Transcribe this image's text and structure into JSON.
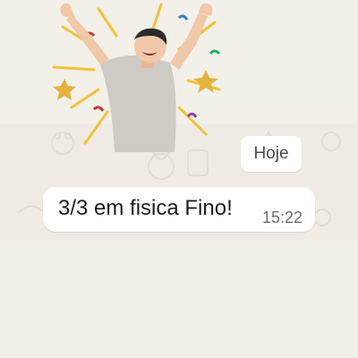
{
  "sticker": {
    "icon": "celebrating-person-sticker-icon"
  },
  "chat": {
    "date_chip": "Hoje",
    "messages": [
      {
        "text": "3/3 em fisica Fino!",
        "time": "15:22"
      }
    ]
  },
  "colors": {
    "background": "#f3f0ea",
    "bubble": "#ffffff",
    "text": "#1d1d1d",
    "timestamp": "#6f6f6f"
  }
}
